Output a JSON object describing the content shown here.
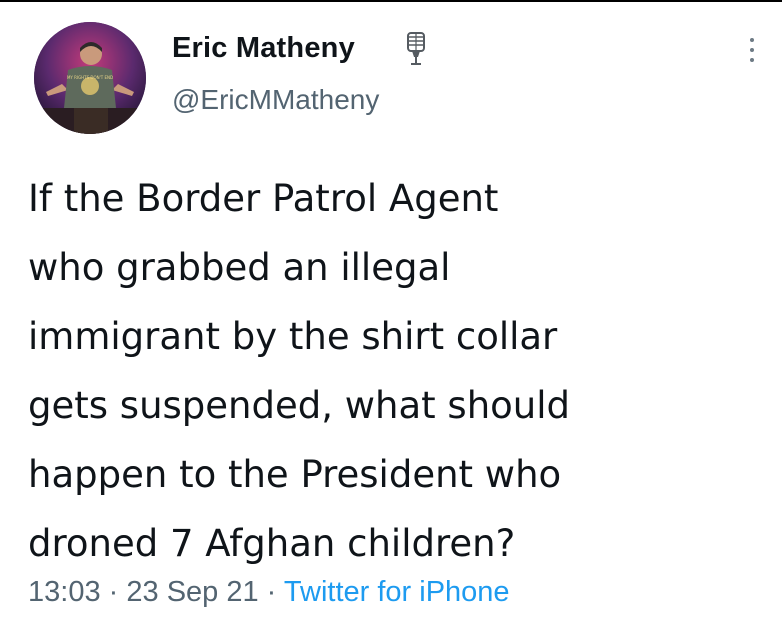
{
  "author": {
    "display_name": "Eric Matheny",
    "handle": "@EricMMatheny",
    "badge_icon": "microphone-icon",
    "avatar_shirt_text": "MY RIGHTS DON'T END"
  },
  "menu": {
    "icon": "more-options-icon"
  },
  "tweet": {
    "text_lines": [
      "If the Border Patrol Agent",
      "who grabbed an illegal",
      "immigrant by the shirt collar",
      "gets suspended, what should",
      "happen to the President who",
      "droned 7 Afghan children?"
    ],
    "time": "13:03",
    "date": "23 Sep 21",
    "separator": "·",
    "source": "Twitter for iPhone"
  },
  "colors": {
    "text": "#0f1419",
    "secondary": "#536471",
    "link": "#1d9bf0"
  }
}
